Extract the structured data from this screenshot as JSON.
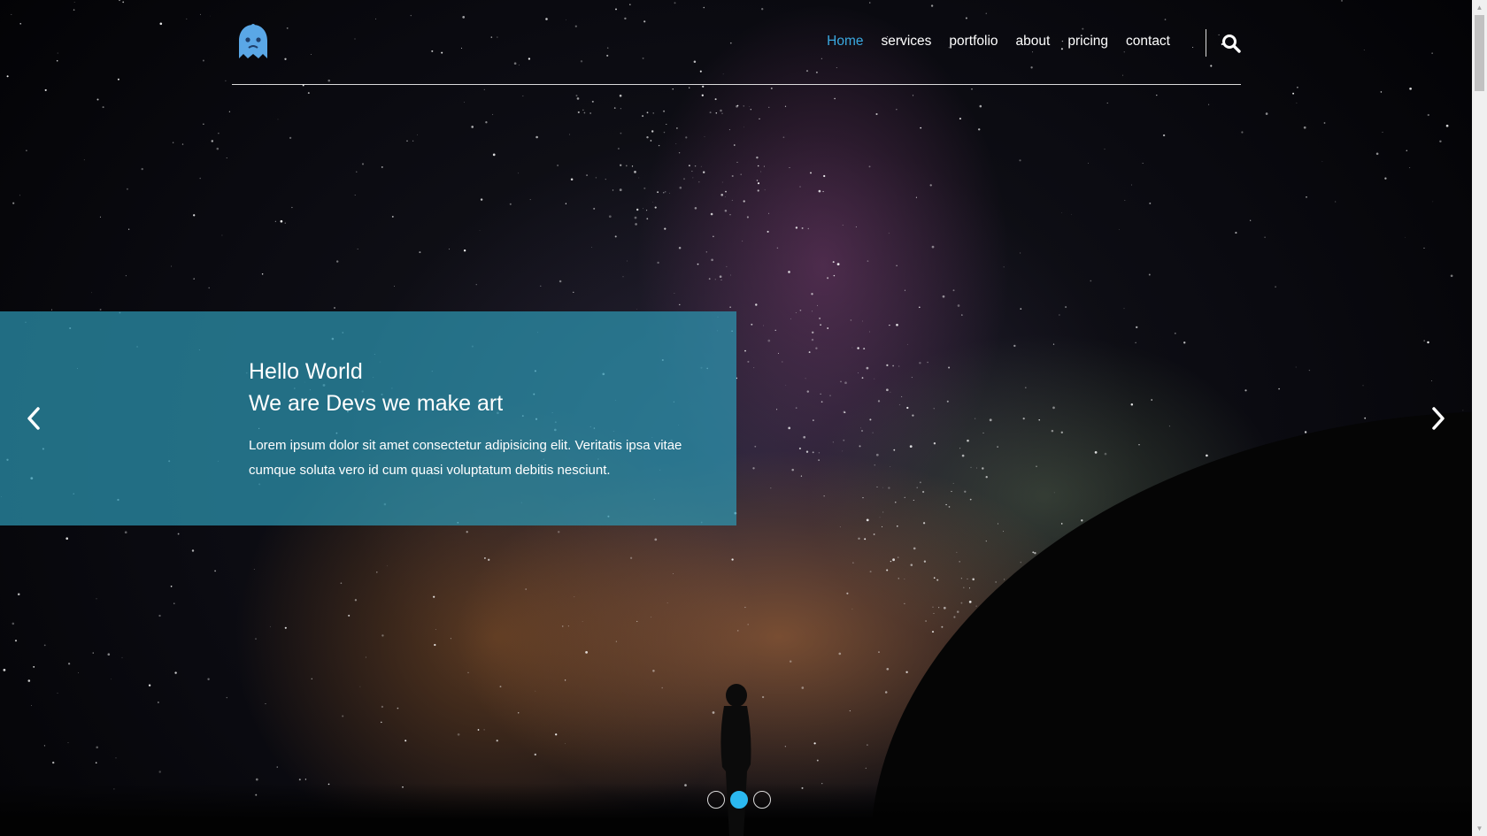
{
  "brand": {
    "logo_icon": "ghost-mascot-icon",
    "accent": "#3aa9e0"
  },
  "nav": {
    "items": [
      {
        "label": "Home",
        "active": true
      },
      {
        "label": "services",
        "active": false
      },
      {
        "label": "portfolio",
        "active": false
      },
      {
        "label": "about",
        "active": false
      },
      {
        "label": "pricing",
        "active": false
      },
      {
        "label": "contact",
        "active": false
      }
    ],
    "search_icon": "search-icon"
  },
  "slide": {
    "title": "Hello World",
    "subtitle": "We are Devs we make art",
    "body": "Lorem ipsum dolor sit amet consectetur adipisicing elit. Veritatis ipsa vitae cumque soluta vero id cum quasi voluptatum debitis nesciunt.",
    "panel_color": "#2c96b2"
  },
  "carousel": {
    "prev_icon": "chevron-left-icon",
    "next_icon": "chevron-right-icon",
    "slides_count": 3,
    "active_index": 1,
    "indicator_active_color": "#2bb8f0"
  }
}
